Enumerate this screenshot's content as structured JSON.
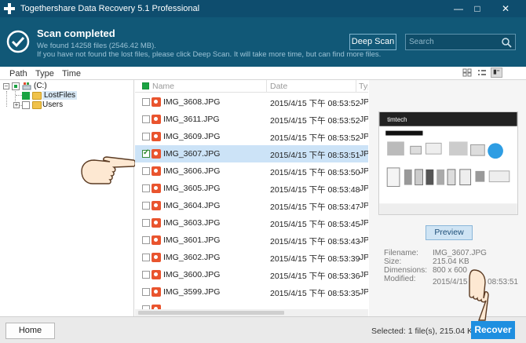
{
  "window": {
    "title": "Togethershare Data Recovery 5.1 Professional",
    "min_glyph": "—",
    "max_glyph": "□",
    "close_glyph": "✕"
  },
  "header": {
    "scan_title": "Scan completed",
    "scan_summary": "We found 14258 files (2546.42 MB).",
    "scan_hint": "If you have not found the lost files, please click Deep Scan. It will take more time, but can find more files.",
    "deep_scan_label": "Deep Scan",
    "search_placeholder": "Search",
    "accent_color": "#115877"
  },
  "tabs": [
    {
      "label": "Path"
    },
    {
      "label": "Type"
    },
    {
      "label": "Time"
    }
  ],
  "view_modes": [
    "grid-view-icon",
    "list-view-icon",
    "detail-view-icon"
  ],
  "tree": {
    "root_label": "(C:)",
    "items": [
      {
        "label": "LostFiles",
        "state": "checked",
        "selected": true
      },
      {
        "label": "Users",
        "state": "unchecked",
        "selected": false
      }
    ]
  },
  "file_list": {
    "columns": {
      "name": "Name",
      "date": "Date",
      "type": "Typ"
    },
    "rows": [
      {
        "name": "IMG_3608.JPG",
        "date": "2015/4/15 下午 08:53:52",
        "type": "JPG",
        "checked": false,
        "selected": false
      },
      {
        "name": "IMG_3611.JPG",
        "date": "2015/4/15 下午 08:53:52",
        "type": "JPG",
        "checked": false,
        "selected": false
      },
      {
        "name": "IMG_3609.JPG",
        "date": "2015/4/15 下午 08:53:52",
        "type": "JPG",
        "checked": false,
        "selected": false
      },
      {
        "name": "IMG_3607.JPG",
        "date": "2015/4/15 下午 08:53:51",
        "type": "JPG",
        "checked": true,
        "selected": true
      },
      {
        "name": "IMG_3606.JPG",
        "date": "2015/4/15 下午 08:53:50",
        "type": "JPG",
        "checked": false,
        "selected": false
      },
      {
        "name": "IMG_3605.JPG",
        "date": "2015/4/15 下午 08:53:48",
        "type": "JPG",
        "checked": false,
        "selected": false
      },
      {
        "name": "IMG_3604.JPG",
        "date": "2015/4/15 下午 08:53:47",
        "type": "JPG",
        "checked": false,
        "selected": false
      },
      {
        "name": "IMG_3603.JPG",
        "date": "2015/4/15 下午 08:53:45",
        "type": "JPG",
        "checked": false,
        "selected": false
      },
      {
        "name": "IMG_3601.JPG",
        "date": "2015/4/15 下午 08:53:43",
        "type": "JPG",
        "checked": false,
        "selected": false
      },
      {
        "name": "IMG_3602.JPG",
        "date": "2015/4/15 下午 08:53:39",
        "type": "JPG",
        "checked": false,
        "selected": false
      },
      {
        "name": "IMG_3600.JPG",
        "date": "2015/4/15 下午 08:53:36",
        "type": "JPG",
        "checked": false,
        "selected": false
      },
      {
        "name": "IMG_3599.JPG",
        "date": "2015/4/15 下午 08:53:35",
        "type": "JPG",
        "checked": false,
        "selected": false
      },
      {
        "name": "",
        "date": "",
        "type": "",
        "checked": false,
        "selected": false
      }
    ]
  },
  "preview": {
    "button_label": "Preview",
    "image_brand": "timtech",
    "filename_key": "Filename:",
    "filename_val": "IMG_3607.JPG",
    "size_key": "Size:",
    "size_val": "215.04 KB",
    "dimensions_key": "Dimensions:",
    "dimensions_val": "800 x 600",
    "modified_key": "Modified:",
    "modified_val": "2015/4/15 下午 08:53:51"
  },
  "footer": {
    "home_label": "Home",
    "selected_info": "Selected: 1 file(s), 215.04 KB",
    "recover_label": "Recover",
    "recover_color": "#1e8fe0"
  }
}
